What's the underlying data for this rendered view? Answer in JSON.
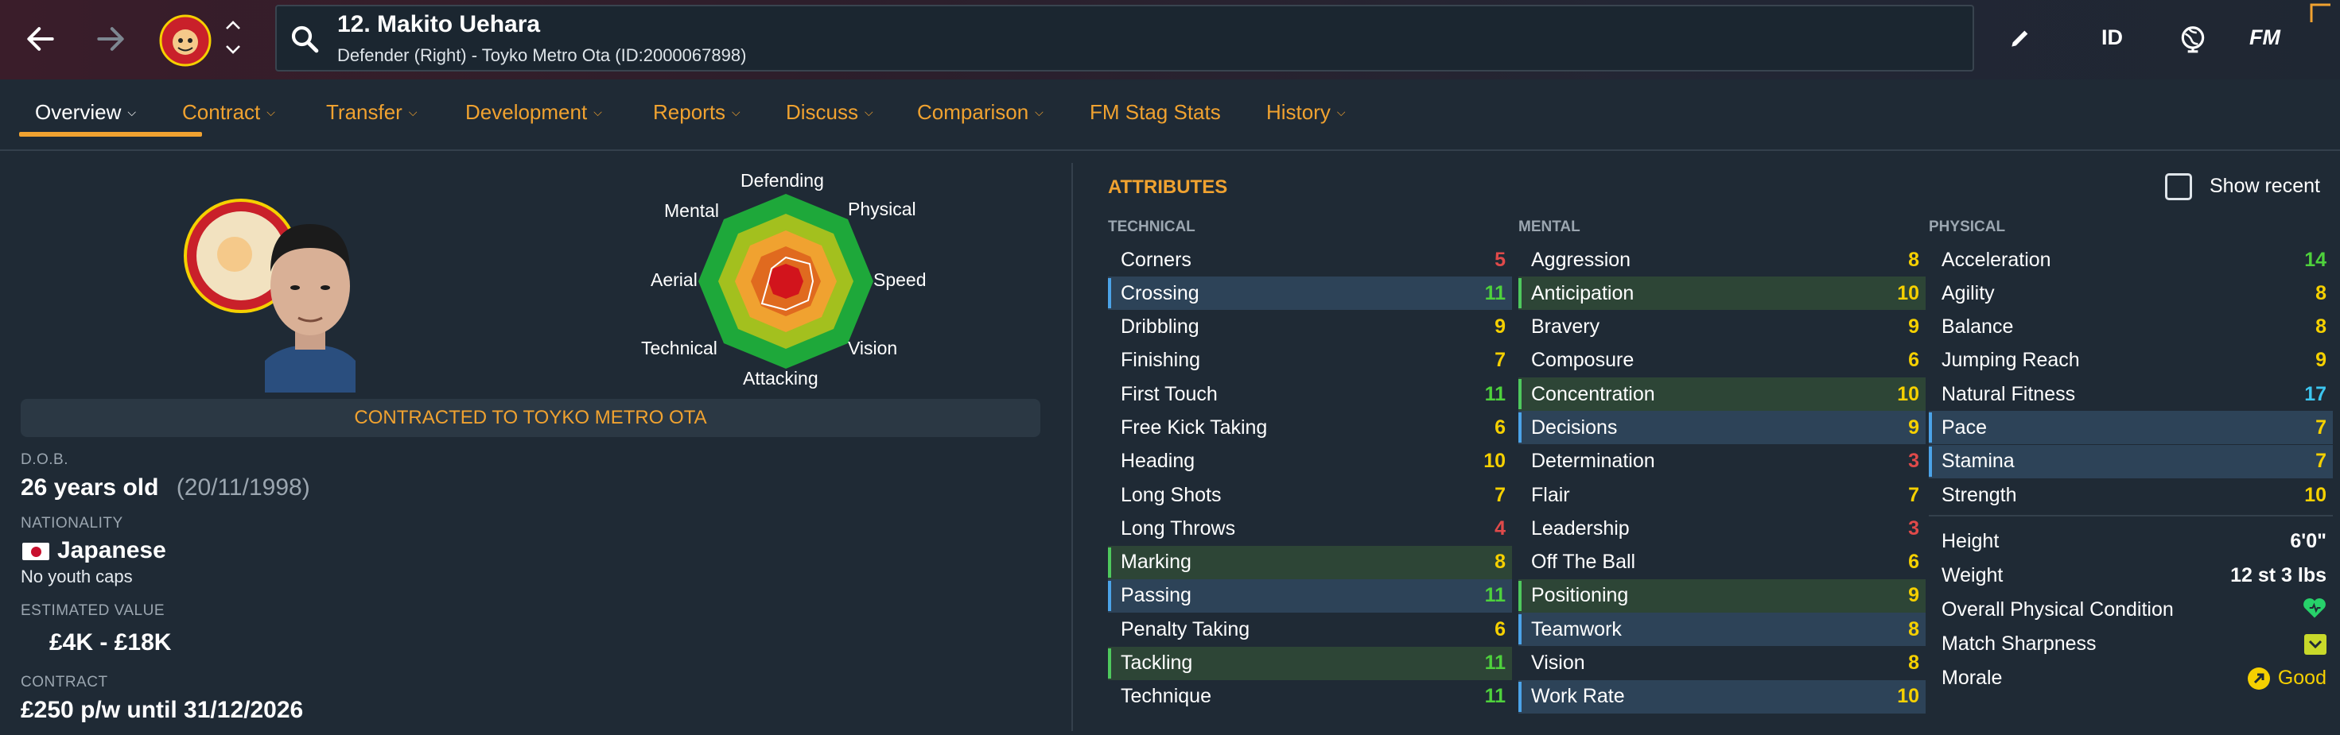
{
  "player": {
    "title": "12. Makito Uehara",
    "subtitle": "Defender (Right) - Toyko Metro Ota (ID:2000067898)"
  },
  "toolbar": {
    "id_label": "ID",
    "fm_label": "FM"
  },
  "tabs": [
    {
      "label": "Overview"
    },
    {
      "label": "Contract"
    },
    {
      "label": "Transfer"
    },
    {
      "label": "Development"
    },
    {
      "label": "Reports"
    },
    {
      "label": "Discuss"
    },
    {
      "label": "Comparison"
    },
    {
      "label": "FM Stag Stats"
    },
    {
      "label": "History"
    }
  ],
  "radar": {
    "labels": {
      "defending": "Defending",
      "physical": "Physical",
      "speed": "Speed",
      "vision": "Vision",
      "attacking": "Attacking",
      "technical": "Technical",
      "aerial": "Aerial",
      "mental": "Mental"
    }
  },
  "contract_banner": "CONTRACTED TO TOYKO METRO OTA",
  "info": {
    "dob_label": "D.O.B.",
    "age": "26 years old",
    "dob": "(20/11/1998)",
    "nationality_label": "NATIONALITY",
    "nationality": "Japanese",
    "youth_caps": "No youth caps",
    "value_label": "ESTIMATED VALUE",
    "value": "£4K - £18K",
    "contract_label": "CONTRACT",
    "contract": "£250 p/w until 31/12/2026"
  },
  "attributes": {
    "title": "ATTRIBUTES",
    "show_recent": "Show recent",
    "technical_label": "TECHNICAL",
    "mental_label": "MENTAL",
    "physical_label": "PHYSICAL",
    "technical": [
      {
        "name": "Corners",
        "value": "5",
        "hl": ""
      },
      {
        "name": "Crossing",
        "value": "11",
        "hl": "blue"
      },
      {
        "name": "Dribbling",
        "value": "9",
        "hl": ""
      },
      {
        "name": "Finishing",
        "value": "7",
        "hl": ""
      },
      {
        "name": "First Touch",
        "value": "11",
        "hl": ""
      },
      {
        "name": "Free Kick Taking",
        "value": "6",
        "hl": ""
      },
      {
        "name": "Heading",
        "value": "10",
        "hl": ""
      },
      {
        "name": "Long Shots",
        "value": "7",
        "hl": ""
      },
      {
        "name": "Long Throws",
        "value": "4",
        "hl": ""
      },
      {
        "name": "Marking",
        "value": "8",
        "hl": "green"
      },
      {
        "name": "Passing",
        "value": "11",
        "hl": "blue"
      },
      {
        "name": "Penalty Taking",
        "value": "6",
        "hl": ""
      },
      {
        "name": "Tackling",
        "value": "11",
        "hl": "green"
      },
      {
        "name": "Technique",
        "value": "11",
        "hl": ""
      }
    ],
    "mental": [
      {
        "name": "Aggression",
        "value": "8",
        "hl": ""
      },
      {
        "name": "Anticipation",
        "value": "10",
        "hl": "green"
      },
      {
        "name": "Bravery",
        "value": "9",
        "hl": ""
      },
      {
        "name": "Composure",
        "value": "6",
        "hl": ""
      },
      {
        "name": "Concentration",
        "value": "10",
        "hl": "green"
      },
      {
        "name": "Decisions",
        "value": "9",
        "hl": "blue"
      },
      {
        "name": "Determination",
        "value": "3",
        "hl": ""
      },
      {
        "name": "Flair",
        "value": "7",
        "hl": ""
      },
      {
        "name": "Leadership",
        "value": "3",
        "hl": ""
      },
      {
        "name": "Off The Ball",
        "value": "6",
        "hl": ""
      },
      {
        "name": "Positioning",
        "value": "9",
        "hl": "green"
      },
      {
        "name": "Teamwork",
        "value": "8",
        "hl": "blue"
      },
      {
        "name": "Vision",
        "value": "8",
        "hl": ""
      },
      {
        "name": "Work Rate",
        "value": "10",
        "hl": "blue"
      }
    ],
    "physical": [
      {
        "name": "Acceleration",
        "value": "14",
        "hl": ""
      },
      {
        "name": "Agility",
        "value": "8",
        "hl": ""
      },
      {
        "name": "Balance",
        "value": "8",
        "hl": ""
      },
      {
        "name": "Jumping Reach",
        "value": "9",
        "hl": ""
      },
      {
        "name": "Natural Fitness",
        "value": "17",
        "hl": ""
      },
      {
        "name": "Pace",
        "value": "7",
        "hl": "blue"
      },
      {
        "name": "Stamina",
        "value": "7",
        "hl": "blue"
      },
      {
        "name": "Strength",
        "value": "10",
        "hl": ""
      }
    ],
    "physical_info": {
      "height_label": "Height",
      "height": "6'0\"",
      "weight_label": "Weight",
      "weight": "12 st 3 lbs",
      "condition_label": "Overall Physical Condition",
      "sharpness_label": "Match Sharpness",
      "morale_label": "Morale",
      "morale": "Good"
    }
  },
  "colors": {
    "accent": "#f0a230",
    "red": "#e04a4a",
    "yellow": "#f5d000",
    "green": "#4ed13c",
    "cyan": "#3cc6f0"
  }
}
